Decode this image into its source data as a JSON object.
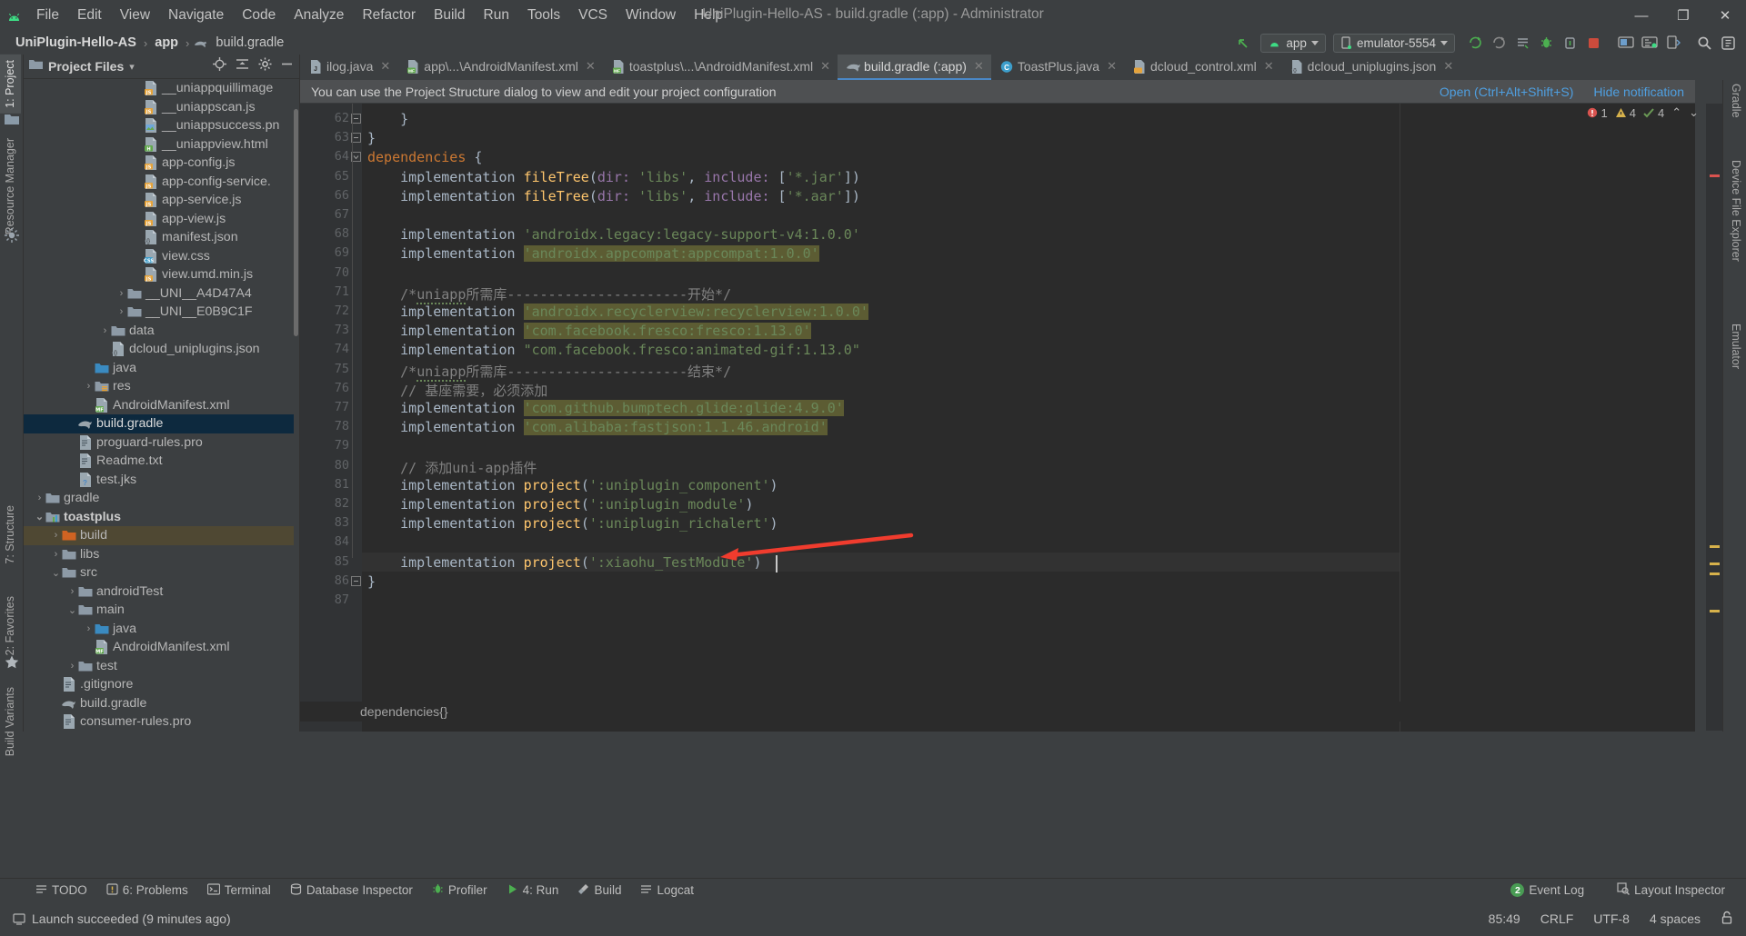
{
  "window": {
    "title": "UniPlugin-Hello-AS - build.gradle (:app) - Administrator",
    "minimize": "—",
    "maximize": "❐",
    "close": "✕"
  },
  "menu": {
    "items": [
      "File",
      "Edit",
      "View",
      "Navigate",
      "Code",
      "Analyze",
      "Refactor",
      "Build",
      "Run",
      "Tools",
      "VCS",
      "Window",
      "Help"
    ]
  },
  "breadcrumb": {
    "project": "UniPlugin-Hello-AS",
    "module": "app",
    "file": "build.gradle",
    "sep": "›"
  },
  "toolbar": {
    "run_config": "app",
    "device": "emulator-5554",
    "sync_icon": "gradle-sync-icon",
    "make_icon": "make-project-icon",
    "avd_icon": "avd-manager-icon",
    "sdk_icon": "sdk-manager-icon",
    "search_icon": "search-everywhere-icon",
    "stop_icon": "stop-icon",
    "debug_icon": "debug-icon",
    "profile_icon": "profiler-icon",
    "apply_icon": "apply-changes-icon",
    "back_arrow_icon": "back-arrow-icon"
  },
  "tabs": [
    {
      "label": "ilog.java",
      "icon": "java-file-icon",
      "active": false,
      "closable": true
    },
    {
      "label": "app\\...\\AndroidManifest.xml",
      "icon": "manifest-file-icon",
      "active": false,
      "closable": true
    },
    {
      "label": "toastplus\\...\\AndroidManifest.xml",
      "icon": "manifest-file-icon",
      "active": false,
      "closable": true
    },
    {
      "label": "build.gradle (:app)",
      "icon": "gradle-file-icon",
      "active": true,
      "closable": true
    },
    {
      "label": "ToastPlus.java",
      "icon": "class-file-icon",
      "active": false,
      "closable": true
    },
    {
      "label": "dcloud_control.xml",
      "icon": "xml-file-icon",
      "active": false,
      "closable": true
    },
    {
      "label": "dcloud_uniplugins.json",
      "icon": "json-file-icon",
      "active": false,
      "closable": true
    }
  ],
  "left_strip": {
    "project_tab": "1: Project",
    "resource_manager_tab": "Resource Manager",
    "structure_tab": "7: Structure",
    "favorites_tab": "2: Favorites",
    "build_variants_tab": "Build Variants"
  },
  "right_strip": {
    "gradle_tab": "Gradle",
    "device_file_explorer_tab": "Device File Explorer",
    "emulator_tab": "Emulator"
  },
  "project_panel": {
    "title": "Project Files",
    "dropdown_caret": "▾",
    "locate_icon": "locate-icon",
    "collapse_icon": "collapse-all-icon",
    "settings_icon": "gear-icon",
    "hide_icon": "hide-icon",
    "tree": [
      {
        "label": "__uniappquillimage",
        "indent": 7,
        "icon": "js",
        "arrow": ""
      },
      {
        "label": "__uniappscan.js",
        "indent": 7,
        "icon": "js",
        "arrow": ""
      },
      {
        "label": "__uniappsuccess.pn",
        "indent": 7,
        "icon": "img",
        "arrow": ""
      },
      {
        "label": "__uniappview.html",
        "indent": 7,
        "icon": "html",
        "arrow": ""
      },
      {
        "label": "app-config.js",
        "indent": 7,
        "icon": "js",
        "arrow": ""
      },
      {
        "label": "app-config-service.",
        "indent": 7,
        "icon": "js",
        "arrow": ""
      },
      {
        "label": "app-service.js",
        "indent": 7,
        "icon": "js",
        "arrow": ""
      },
      {
        "label": "app-view.js",
        "indent": 7,
        "icon": "js",
        "arrow": ""
      },
      {
        "label": "manifest.json",
        "indent": 7,
        "icon": "json",
        "arrow": ""
      },
      {
        "label": "view.css",
        "indent": 7,
        "icon": "css",
        "arrow": ""
      },
      {
        "label": "view.umd.min.js",
        "indent": 7,
        "icon": "js",
        "arrow": ""
      },
      {
        "label": "__UNI__A4D47A4",
        "indent": 6,
        "icon": "folder",
        "arrow": "›"
      },
      {
        "label": "__UNI__E0B9C1F",
        "indent": 6,
        "icon": "folder",
        "arrow": "›"
      },
      {
        "label": "data",
        "indent": 5,
        "icon": "folder",
        "arrow": "›"
      },
      {
        "label": "dcloud_uniplugins.json",
        "indent": 5,
        "icon": "json",
        "arrow": ""
      },
      {
        "label": "java",
        "indent": 4,
        "icon": "folder-src",
        "arrow": ""
      },
      {
        "label": "res",
        "indent": 4,
        "icon": "folder-res",
        "arrow": "›"
      },
      {
        "label": "AndroidManifest.xml",
        "indent": 4,
        "icon": "manifest",
        "arrow": ""
      },
      {
        "label": "build.gradle",
        "indent": 3,
        "icon": "gradle",
        "arrow": "",
        "state": "selected"
      },
      {
        "label": "proguard-rules.pro",
        "indent": 3,
        "icon": "text",
        "arrow": ""
      },
      {
        "label": "Readme.txt",
        "indent": 3,
        "icon": "text",
        "arrow": ""
      },
      {
        "label": "test.jks",
        "indent": 3,
        "icon": "unknown",
        "arrow": ""
      },
      {
        "label": "gradle",
        "indent": 1,
        "icon": "folder",
        "arrow": "›"
      },
      {
        "label": "toastplus",
        "indent": 1,
        "icon": "module",
        "arrow": "∨",
        "state": "bold"
      },
      {
        "label": "build",
        "indent": 2,
        "icon": "folder-excluded",
        "arrow": "›",
        "state": "build-hl"
      },
      {
        "label": "libs",
        "indent": 2,
        "icon": "folder",
        "arrow": "›"
      },
      {
        "label": "src",
        "indent": 2,
        "icon": "folder",
        "arrow": "∨"
      },
      {
        "label": "androidTest",
        "indent": 3,
        "icon": "folder",
        "arrow": "›"
      },
      {
        "label": "main",
        "indent": 3,
        "icon": "folder",
        "arrow": "∨"
      },
      {
        "label": "java",
        "indent": 4,
        "icon": "folder-src",
        "arrow": "›"
      },
      {
        "label": "AndroidManifest.xml",
        "indent": 4,
        "icon": "manifest",
        "arrow": ""
      },
      {
        "label": "test",
        "indent": 3,
        "icon": "folder",
        "arrow": "›"
      },
      {
        "label": ".gitignore",
        "indent": 2,
        "icon": "text",
        "arrow": ""
      },
      {
        "label": "build.gradle",
        "indent": 2,
        "icon": "gradle",
        "arrow": ""
      },
      {
        "label": "consumer-rules.pro",
        "indent": 2,
        "icon": "text",
        "arrow": ""
      }
    ]
  },
  "notification": {
    "text": "You can use the Project Structure dialog to view and edit your project configuration",
    "open_link": "Open (Ctrl+Alt+Shift+S)",
    "hide_link": "Hide notification"
  },
  "inspections": {
    "error_count": "1",
    "warning_count": "4",
    "weak_warning_count": "4",
    "up_arrow": "⌃",
    "down_arrow": "⌄"
  },
  "editor": {
    "first_line": 62,
    "breadcrumb": "dependencies{}",
    "lines": [
      {
        "n": 62,
        "html": "    }",
        "fold": "-"
      },
      {
        "n": 63,
        "html": "}",
        "fold": "-"
      },
      {
        "n": 64,
        "html": "<span class='kw'>dependencies</span> {",
        "fold": "v"
      },
      {
        "n": 65,
        "html": "    implementation <span class='fn'>fileTree</span>(<span class='param'>dir:</span> <span class='str'>'libs'</span>, <span class='param'>include:</span> [<span class='str'>'*.jar'</span>])"
      },
      {
        "n": 66,
        "html": "    implementation <span class='fn'>fileTree</span>(<span class='param'>dir:</span> <span class='str'>'libs'</span>, <span class='param'>include:</span> [<span class='str'>'*.aar'</span>])"
      },
      {
        "n": 67,
        "html": ""
      },
      {
        "n": 68,
        "html": "    implementation <span class='str'>'androidx.legacy:legacy-support-v4:1.0.0'</span>"
      },
      {
        "n": 69,
        "html": "    implementation <span class='str hl'>'androidx.appcompat:appcompat:1.0.0'</span>"
      },
      {
        "n": 70,
        "html": ""
      },
      {
        "n": 71,
        "html": "    <span class='com'>/*<span class='squig'>uniapp</span>所需库----------------------开始*/</span>"
      },
      {
        "n": 72,
        "html": "    implementation <span class='str hl'>'androidx.recyclerview:recyclerview:1.0.0'</span>"
      },
      {
        "n": 73,
        "html": "    implementation <span class='str hl'>'com.facebook.fresco:fresco:1.13.0'</span>"
      },
      {
        "n": 74,
        "html": "    implementation <span class='str'>\"com.facebook.fresco:animated-gif:1.13.0\"</span>"
      },
      {
        "n": 75,
        "html": "    <span class='com'>/*<span class='squig'>uniapp</span>所需库----------------------结束*/</span>"
      },
      {
        "n": 76,
        "html": "    <span class='com'>// 基座需要，必须添加</span>"
      },
      {
        "n": 77,
        "html": "    implementation <span class='str hl'>'com.github.bumptech.glide:glide:4.9.0'</span>"
      },
      {
        "n": 78,
        "html": "    implementation <span class='str hl'>'com.alibaba:fastjson:1.1.46.android'</span>"
      },
      {
        "n": 79,
        "html": ""
      },
      {
        "n": 80,
        "html": "    <span class='com'>// 添加uni-app插件</span>"
      },
      {
        "n": 81,
        "html": "    implementation <span class='fn'>project</span>(<span class='str'>':uniplugin_component'</span>)"
      },
      {
        "n": 82,
        "html": "    implementation <span class='fn'>project</span>(<span class='str'>':uniplugin_module'</span>)"
      },
      {
        "n": 83,
        "html": "    implementation <span class='fn'>project</span>(<span class='str'>':uniplugin_richalert'</span>)"
      },
      {
        "n": 84,
        "html": "",
        "dim": true
      },
      {
        "n": 85,
        "html": "    implementation <span class='fn'>project</span>(<span class='str'>':xiaohu_TestModule'</span>)",
        "caret": true
      },
      {
        "n": 86,
        "html": "}",
        "fold": "-"
      },
      {
        "n": 87,
        "html": ""
      }
    ]
  },
  "bottom_windows": [
    {
      "label": "TODO",
      "icon": "todo-icon"
    },
    {
      "label": "6: Problems",
      "icon": "problems-icon"
    },
    {
      "label": "Terminal",
      "icon": "terminal-icon"
    },
    {
      "label": "Database Inspector",
      "icon": "database-icon"
    },
    {
      "label": "Profiler",
      "icon": "profiler-icon"
    },
    {
      "label": "4: Run",
      "icon": "run-icon"
    },
    {
      "label": "Build",
      "icon": "build-icon"
    },
    {
      "label": "Logcat",
      "icon": "logcat-icon"
    }
  ],
  "bottom_right": {
    "event_log": "Event Log",
    "event_log_count": "2",
    "layout_inspector": "Layout Inspector",
    "layout_inspector_icon": "layout-inspector-icon"
  },
  "statusbar": {
    "message": "Launch succeeded (9 minutes ago)",
    "message_icon": "status-info-icon",
    "caret_position": "85:49",
    "line_separator": "CRLF",
    "encoding": "UTF-8",
    "indent": "4 spaces",
    "lock_icon": "unlocked-icon"
  },
  "annotation": {
    "arrow_color": "#f03c2e"
  }
}
